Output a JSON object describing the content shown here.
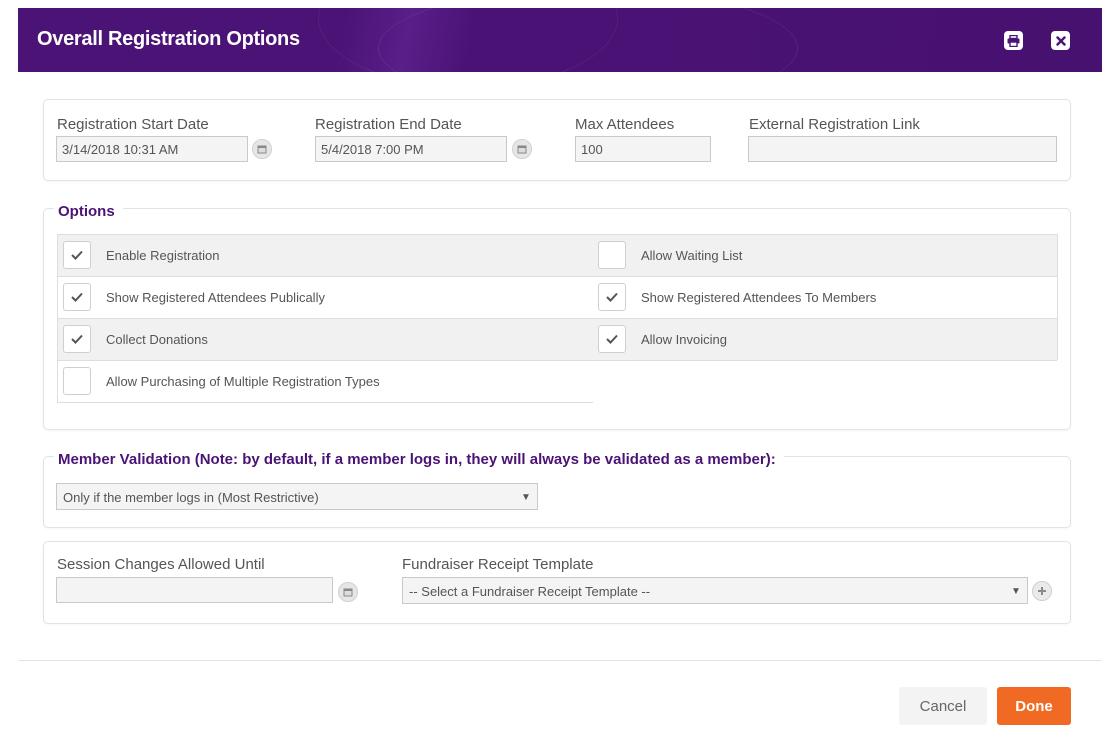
{
  "dialog": {
    "title": "Overall Registration Options",
    "print_icon": "print-icon",
    "close_icon": "close-icon"
  },
  "registration": {
    "start_date_label": "Registration Start Date",
    "start_date_value": "3/14/2018 10:31 AM",
    "end_date_label": "Registration End Date",
    "end_date_value": "5/4/2018 7:00 PM",
    "max_attendees_label": "Max Attendees",
    "max_attendees_value": "100",
    "external_link_label": "External Registration Link",
    "external_link_value": "",
    "calendar_icon": "calendar-icon"
  },
  "options": {
    "legend": "Options",
    "items": [
      {
        "label": "Enable Registration",
        "checked": true
      },
      {
        "label": "Allow Waiting List",
        "checked": false
      },
      {
        "label": "Show Registered Attendees Publically",
        "checked": true
      },
      {
        "label": "Show Registered Attendees To Members",
        "checked": true
      },
      {
        "label": "Collect Donations",
        "checked": true
      },
      {
        "label": "Allow Invoicing",
        "checked": true
      },
      {
        "label": "Allow Purchasing of Multiple Registration Types",
        "checked": false
      }
    ]
  },
  "member_validation": {
    "legend": "Member Validation (Note: by default, if a member logs in, they will always be validated as a member):",
    "selected": "Only if the member logs in (Most Restrictive)"
  },
  "session": {
    "changes_label": "Session Changes Allowed Until",
    "changes_value": "",
    "receipt_label": "Fundraiser Receipt Template",
    "receipt_selected": "-- Select a Fundraiser Receipt Template --",
    "add_icon": "plus-icon"
  },
  "footer": {
    "cancel_label": "Cancel",
    "done_label": "Done"
  },
  "colors": {
    "header": "#4a1275",
    "accent": "#4b1376",
    "done_button": "#f06a23"
  }
}
